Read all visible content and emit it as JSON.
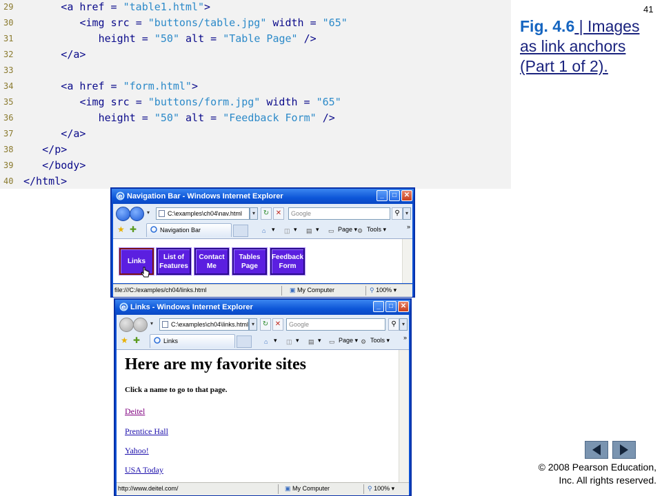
{
  "slide_number": "41",
  "code_listing": [
    {
      "num": "29",
      "indent": 6,
      "parts": [
        [
          "<a href = ",
          "t"
        ],
        [
          "\"table1.html\"",
          "s"
        ],
        [
          ">",
          "t"
        ]
      ]
    },
    {
      "num": "30",
      "indent": 9,
      "parts": [
        [
          "<img src = ",
          "t"
        ],
        [
          "\"buttons/table.jpg\"",
          "s"
        ],
        [
          " width = ",
          "t"
        ],
        [
          "\"65\"",
          "s"
        ]
      ]
    },
    {
      "num": "31",
      "indent": 12,
      "parts": [
        [
          "height = ",
          "t"
        ],
        [
          "\"50\"",
          "s"
        ],
        [
          " alt = ",
          "t"
        ],
        [
          "\"Table Page\"",
          "s"
        ],
        [
          " />",
          "t"
        ]
      ]
    },
    {
      "num": "32",
      "indent": 6,
      "parts": [
        [
          "</a>",
          "t"
        ]
      ]
    },
    {
      "num": "33",
      "indent": 0,
      "parts": []
    },
    {
      "num": "34",
      "indent": 6,
      "parts": [
        [
          "<a href = ",
          "t"
        ],
        [
          "\"form.html\"",
          "s"
        ],
        [
          ">",
          "t"
        ]
      ]
    },
    {
      "num": "35",
      "indent": 9,
      "parts": [
        [
          "<img src = ",
          "t"
        ],
        [
          "\"buttons/form.jpg\"",
          "s"
        ],
        [
          " width = ",
          "t"
        ],
        [
          "\"65\"",
          "s"
        ]
      ]
    },
    {
      "num": "36",
      "indent": 12,
      "parts": [
        [
          "height = ",
          "t"
        ],
        [
          "\"50\"",
          "s"
        ],
        [
          " alt = ",
          "t"
        ],
        [
          "\"Feedback Form\"",
          "s"
        ],
        [
          " />",
          "t"
        ]
      ]
    },
    {
      "num": "37",
      "indent": 6,
      "parts": [
        [
          "</a>",
          "t"
        ]
      ]
    },
    {
      "num": "38",
      "indent": 3,
      "parts": [
        [
          "</p>",
          "t"
        ]
      ]
    },
    {
      "num": "39",
      "indent": 3,
      "parts": [
        [
          "</body>",
          "t"
        ]
      ]
    },
    {
      "num": "40",
      "indent": 0,
      "parts": [
        [
          "</html>",
          "t"
        ]
      ]
    }
  ],
  "figure": {
    "link_label": "Fig. 4.6",
    "separator": " | ",
    "caption": "Images as link anchors (Part 1 of 2)."
  },
  "copyright": {
    "line1": "© 2008 Pearson Education,",
    "line2": "Inc.  All rights reserved."
  },
  "navigation": {
    "prev_icon": "triangle-left-icon",
    "next_icon": "triangle-right-icon"
  },
  "window_nav": {
    "title": "Navigation Bar - Windows Internet Explorer",
    "address": "C:\\examples\\ch04\\nav.html",
    "search_placeholder": "Google",
    "tab_label": "Navigation Bar",
    "page_label": "Page",
    "tools_label": "Tools",
    "image_buttons": [
      "Links",
      "List of\nFeatures",
      "Contact\nMe",
      "Tables\nPage",
      "Feedback\nForm"
    ],
    "status_url": "file:///C:/examples/ch04/links.html",
    "zone": "My Computer",
    "zoom": "100%"
  },
  "window_links": {
    "title": "Links - Windows Internet Explorer",
    "address": "C:\\examples\\ch04\\links.html",
    "search_placeholder": "Google",
    "tab_label": "Links",
    "page_label": "Page",
    "tools_label": "Tools",
    "heading": "Here are my favorite sites",
    "instruction": "Click a name to go to that page.",
    "links": [
      "Deitel",
      "Prentice Hall",
      "Yahoo!",
      "USA Today"
    ],
    "status_url": "http://www.deitel.com/",
    "zone": "My Computer",
    "zoom": "100%"
  },
  "colors": {
    "code_background": "#f2f2f2",
    "code_text": "#0a0a8a",
    "code_string": "#2c8ac9",
    "line_number": "#8a7a2e",
    "image_button": "#5b1fe0",
    "link_visited": "#800080",
    "link": "#1a0dab"
  }
}
